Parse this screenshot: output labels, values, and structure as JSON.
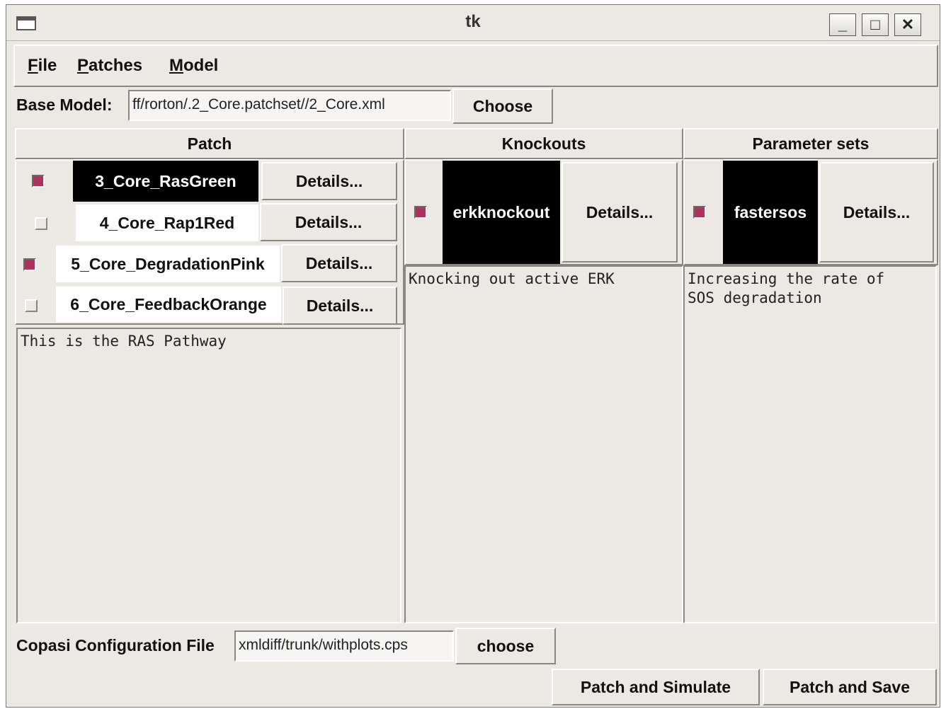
{
  "window": {
    "title": "tk",
    "controls": {
      "minimize": "_",
      "maximize": "□",
      "close": "✕"
    }
  },
  "menubar": {
    "items": [
      {
        "label": "File",
        "mnemonic": "F",
        "rest": "ile"
      },
      {
        "label": "Patches",
        "mnemonic": "P",
        "rest": "atches"
      },
      {
        "label": "Model",
        "mnemonic": "M",
        "rest": "odel"
      }
    ]
  },
  "base_model": {
    "label": "Base Model:",
    "value": "ff/rorton/.2_Core.patchset//2_Core.xml",
    "choose_label": "Choose"
  },
  "columns": {
    "patch": "Patch",
    "knockouts": "Knockouts",
    "parameter_sets": "Parameter sets"
  },
  "patches": [
    {
      "name": "3_Core_RasGreen",
      "checked": true,
      "selected": true,
      "details": "Details..."
    },
    {
      "name": "4_Core_Rap1Red",
      "checked": false,
      "selected": false,
      "details": "Details..."
    },
    {
      "name": "5_Core_DegradationPink",
      "checked": true,
      "selected": false,
      "details": "Details..."
    },
    {
      "name": "6_Core_FeedbackOrange",
      "checked": false,
      "selected": false,
      "details": "Details..."
    }
  ],
  "patch_description": "This is the RAS Pathway",
  "knockouts": [
    {
      "name": "erkknockout",
      "checked": true,
      "selected": true,
      "details": "Details..."
    }
  ],
  "knockout_description": "Knocking out active ERK",
  "parameter_sets": [
    {
      "name": "fastersos",
      "checked": true,
      "selected": true,
      "details": "Details..."
    }
  ],
  "parameter_description": "Increasing the rate of\nSOS degradation",
  "copasi": {
    "label": "Copasi Configuration File",
    "value": "xmldiff/trunk/withplots.cps",
    "choose_label": "choose"
  },
  "actions": {
    "simulate": "Patch and Simulate",
    "save": "Patch and Save"
  },
  "colors": {
    "check_on": "#b03060",
    "background": "#ece9e5",
    "selected_bg": "#000000"
  }
}
